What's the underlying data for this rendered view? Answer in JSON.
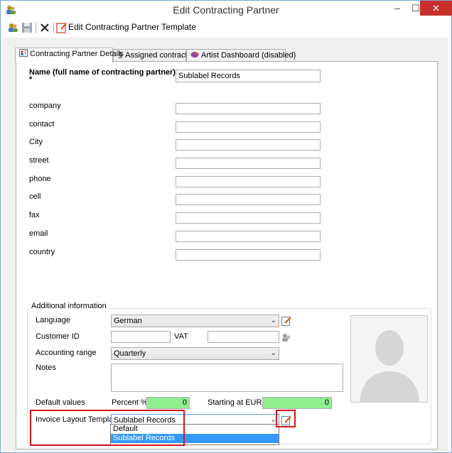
{
  "window": {
    "title": "Edit Contracting Partner",
    "minimize": "–",
    "maximize": "☐",
    "close": "✕"
  },
  "toolbar": {
    "template_label": "Edit Contracting Partner Template"
  },
  "tabs": [
    {
      "label": "Contracting Partner Details",
      "icon": "card-icon",
      "active": true
    },
    {
      "label": "Assigned contracts",
      "icon": "section-sign-icon",
      "symbol": "§",
      "active": false
    },
    {
      "label": "Artist Dashboard (disabled)",
      "icon": "pie-chart-icon",
      "active": false
    }
  ],
  "form": {
    "name_label": "Name (full name of contracting partner)",
    "name_required": "*",
    "name_value": "Sublabel Records",
    "fields": [
      {
        "label": "company",
        "value": ""
      },
      {
        "label": "contact",
        "value": ""
      },
      {
        "label": "City",
        "value": ""
      },
      {
        "label": "street",
        "value": ""
      },
      {
        "label": "phone",
        "value": ""
      },
      {
        "label": "cell",
        "value": ""
      },
      {
        "label": "fax",
        "value": ""
      },
      {
        "label": "email",
        "value": ""
      },
      {
        "label": "country",
        "value": ""
      }
    ]
  },
  "additional": {
    "title": "Additional information",
    "language_label": "Language",
    "language_value": "German",
    "customer_id_label": "Customer ID",
    "customer_id_value": "",
    "vat_label": "VAT",
    "vat_value": "",
    "accounting_label": "Accounting range",
    "accounting_value": "Quarterly",
    "notes_label": "Notes",
    "notes_value": "",
    "defaults_label": "Default values",
    "percent_label": "Percent %",
    "percent_value": "0",
    "starting_label": "Starting at EUR",
    "starting_value": "0",
    "invoice_label": "Invoice Layout Template",
    "invoice_value": "Sublabel Records",
    "invoice_options": [
      "Default",
      "Sublabel Records"
    ]
  },
  "colors": {
    "close_button": "#c7302b",
    "highlight_box": "#d4181c",
    "selected_option": "#3399ff",
    "green_field": "#90ee90"
  }
}
